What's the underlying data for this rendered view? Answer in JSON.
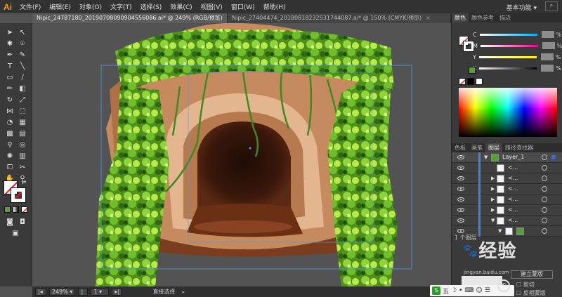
{
  "app": {
    "logo": "Ai"
  },
  "menu": [
    "文件(F)",
    "编辑(E)",
    "对象(O)",
    "文字(T)",
    "选择(S)",
    "效果(C)",
    "视图(V)",
    "窗口(W)",
    "帮助(H)"
  ],
  "workspace": "基本功能",
  "tabs": [
    {
      "label": "Nipic_24787180_20190708090904556086.ai* @ 249% (RGB/预览)",
      "active": true
    },
    {
      "label": "Nipic_27404474_20180818232531744087.ai* @ 150% (CMYK/预览)",
      "active": false
    }
  ],
  "color_panel": {
    "tabs": [
      "颜色",
      "颜色参考",
      "描边"
    ],
    "channels": [
      {
        "label": "C",
        "unit": "%"
      },
      {
        "label": "M",
        "unit": "%"
      },
      {
        "label": "Y",
        "unit": "%"
      },
      {
        "label": "K",
        "unit": "%"
      }
    ],
    "current_color": "#5a9e3a"
  },
  "layers_panel": {
    "tabs": [
      "色板",
      "画笔",
      "图层",
      "路径查找器"
    ],
    "layer_name": "Layer_1",
    "sublayer_label": "<...",
    "footer": "1 个图层"
  },
  "status": {
    "zoom": "249%",
    "page": "1",
    "tool": "直接选择"
  },
  "bottom_right": {
    "labels": [
      "剪切",
      "反相蒙版"
    ],
    "button": "建立蒙版",
    "watermark": "经验",
    "watermark_sub": "jingyan.baidu.com"
  },
  "ime": {
    "label": "五"
  }
}
